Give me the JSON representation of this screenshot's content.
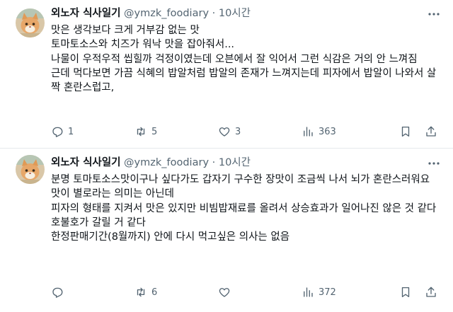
{
  "tweets": [
    {
      "author": {
        "name": "외노자 식사일기",
        "handle": "@ymzk_foodiary",
        "time": "10시간"
      },
      "separator": "·",
      "lines": [
        "맛은 생각보다 크게 거부감 없는 맛",
        "토마토소스와 치즈가 워낙 맛을 잡아줘서...",
        "나물이 우적우적 씹힐까 걱정이였는데 오븐에서 잘 익어서 그런 식감은 거의 안 느껴짐",
        "근데 먹다보면 가끔 식혜의 밥알처럼 밥알의 존재가 느껴지는데 피자에서 밥알이 나와서 살짝 혼란스럽고,"
      ],
      "stats": {
        "replies": "1",
        "retweets": "5",
        "likes": "3",
        "views": "363"
      }
    },
    {
      "author": {
        "name": "외노자 식사일기",
        "handle": "@ymzk_foodiary",
        "time": "10시간"
      },
      "separator": "·",
      "lines": [
        "분명 토마토소스맛이구나 싶다가도 갑자기 구수한 장맛이 조금씩 나서 뇌가 혼란스러워요",
        "맛이 별로라는 의미는 아닌데",
        "피자의 형태를 지켜서 맛은 있지만 비빔밥재료를 올려서 상승효과가 일어나진 않은 것 같다",
        "호불호가 갈릴 거 같다",
        "한정판매기간(8월까지) 안에 다시 먹고싶은 의사는 없음"
      ],
      "stats": {
        "replies": "",
        "retweets": "6",
        "likes": "",
        "views": "372"
      }
    }
  ],
  "icons": {
    "more": "more-dots-icon",
    "reply": "reply-icon",
    "retweet": "retweet-icon",
    "like": "heart-icon",
    "views": "views-chart-icon",
    "bookmark": "bookmark-icon",
    "share": "share-icon"
  },
  "colors": {
    "text": "#0f1419",
    "secondary": "#536471",
    "divider": "#e6e9ec",
    "background": "#ffffff"
  }
}
